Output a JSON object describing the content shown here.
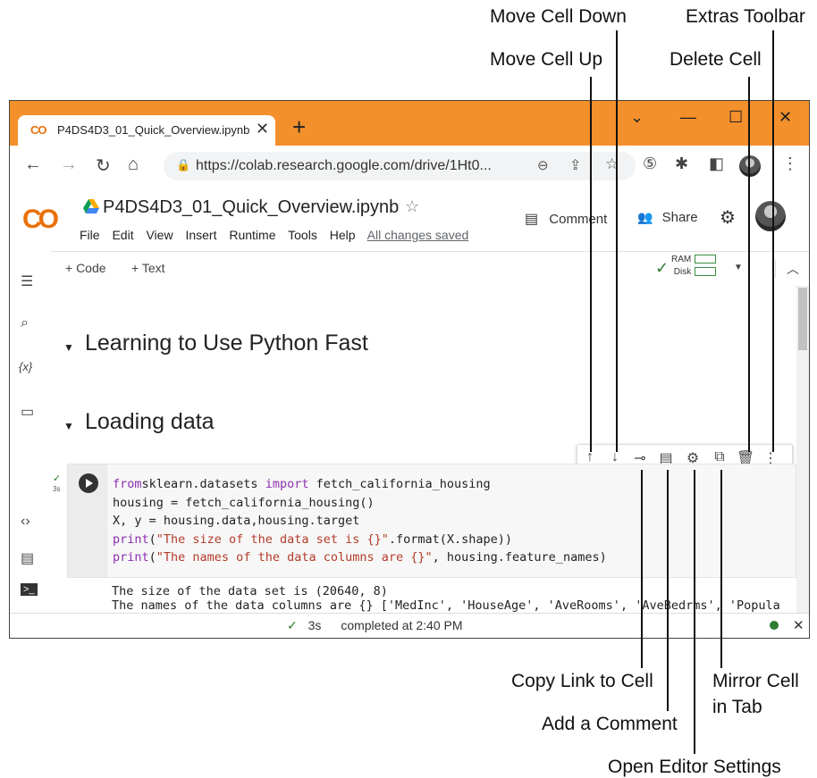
{
  "callouts": {
    "move_cell_down": "Move Cell Down",
    "extras_toolbar": "Extras Toolbar",
    "move_cell_up": "Move Cell Up",
    "delete_cell": "Delete Cell",
    "copy_link": "Copy Link to Cell",
    "mirror_cell_line1": "Mirror Cell",
    "mirror_cell_line2": "in Tab",
    "add_comment": "Add a Comment",
    "editor_settings": "Open Editor Settings"
  },
  "browser": {
    "tab_title": "P4DS4D3_01_Quick_Overview.ipynb",
    "tab_logo": "CO",
    "tab_close": "✕",
    "new_tab": "+",
    "url": "https://colab.research.google.com/drive/1Ht0...",
    "window_controls": [
      "⌄",
      "—",
      "☐",
      "✕"
    ],
    "nav_icons": [
      "←",
      "→",
      "↻",
      "⌂"
    ]
  },
  "colab": {
    "logo": "CO",
    "notebook_title": "P4DS4D3_01_Quick_Overview.ipynb",
    "menu": [
      "File",
      "Edit",
      "View",
      "Insert",
      "Runtime",
      "Tools",
      "Help"
    ],
    "saved_status": "All changes saved",
    "comment_label": "Comment",
    "share_label": "Share",
    "add_code": "+ Code",
    "add_text": "+ Text",
    "ram_label": "RAM",
    "disk_label": "Disk"
  },
  "sections": [
    "Learning to Use Python Fast",
    "Loading data"
  ],
  "cell": {
    "exec_time": "3s",
    "code_lines": [
      {
        "parts": [
          [
            "kw",
            "from"
          ],
          [
            "",
            "sklearn.datasets "
          ],
          [
            "kw",
            "import"
          ],
          [
            "",
            " fetch_california_housing"
          ]
        ]
      },
      {
        "parts": [
          [
            "",
            "housing = fetch_california_housing()"
          ]
        ]
      },
      {
        "parts": [
          [
            "",
            "X, y = housing.data,housing.target"
          ]
        ]
      },
      {
        "parts": [
          [
            "kw",
            "print"
          ],
          [
            "",
            "("
          ],
          [
            "str",
            "\"The size of the data set is {}\""
          ],
          [
            "",
            ".format(X.shape))"
          ]
        ]
      },
      {
        "parts": [
          [
            "kw",
            "print"
          ],
          [
            "",
            "("
          ],
          [
            "str",
            "\"The names of the data columns are {}\""
          ],
          [
            "",
            ", housing.feature_names)"
          ]
        ]
      }
    ],
    "output_lines": [
      "The size of the data set is (20640, 8)",
      "The names of the data columns are {} ['MedInc', 'HouseAge', 'AveRooms', 'AveBedrms', 'Popula"
    ]
  },
  "status": {
    "check": "✓",
    "time": "3s",
    "text": "completed at 2:40 PM"
  },
  "colors": {
    "tabbar": "#f4902b",
    "colab_orange": "#e8710a",
    "colab_yellow": "#f9ab00",
    "keyword": "#8c2fb0",
    "string": "#b33c2a",
    "success": "#2e7d32"
  }
}
